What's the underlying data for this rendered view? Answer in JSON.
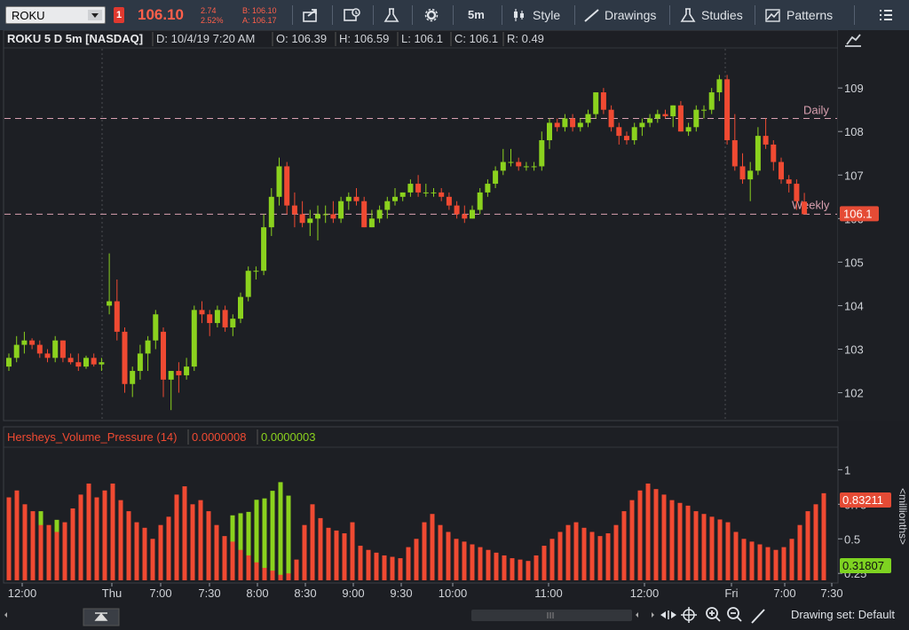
{
  "toolbar": {
    "symbol": "ROKU",
    "alert_badge": "1",
    "last_price": "106.10",
    "net_change": "2.74",
    "pct_change": "2.52%",
    "bid": "B: 106.10",
    "ask": "A: 106.17",
    "aggregation": "5m",
    "style_label": "Style",
    "drawings_label": "Drawings",
    "studies_label": "Studies",
    "patterns_label": "Patterns"
  },
  "header": {
    "title": "ROKU 5 D 5m [NASDAQ]",
    "date": "D: 10/4/19 7:20 AM",
    "open": "O: 106.39",
    "high": "H: 106.59",
    "low": "L: 106.1",
    "close": "C: 106.1",
    "range": "R: 0.49"
  },
  "price_panel": {
    "y_ticks": [
      "109",
      "108",
      "107",
      "106",
      "105",
      "104",
      "103",
      "102"
    ],
    "daily_label": "Daily",
    "weekly_label": "Weekly",
    "current_price_label": "106.1"
  },
  "study": {
    "name": "Hersheys_Volume_Pressure (14)",
    "value_red": "0.0000008",
    "value_green": "0.0000003",
    "y_ticks": [
      "1",
      "0.75",
      "0.5",
      "0.25"
    ],
    "axis_label": "<millionths>",
    "red_readout": "0.83211",
    "green_readout": "0.31807"
  },
  "x_axis": {
    "labels": [
      "12:00",
      "Thu",
      "7:00",
      "7:30",
      "8:00",
      "8:30",
      "9:00",
      "9:30",
      "10:00",
      "11:00",
      "12:00",
      "Fri",
      "7:00",
      "7:30"
    ]
  },
  "bottom": {
    "drawing_set": "Drawing set: Default"
  },
  "colors": {
    "up": "#8bd21e",
    "down": "#f04a32",
    "price_tag": "#e54b35",
    "green_tag": "#7ed321",
    "level_line": "#d9a0b0"
  },
  "chart_data": [
    {
      "type": "candlestick",
      "title": "ROKU 5 D 5m [NASDAQ]",
      "ylim": [
        101.4,
        109.9
      ],
      "y_ticks": [
        109,
        108,
        107,
        106,
        105,
        104,
        103,
        102
      ],
      "levels": [
        {
          "name": "Daily",
          "value": 108.3
        },
        {
          "name": "Weekly",
          "value": 106.1
        }
      ],
      "candles": [
        [
          102.6,
          102.9,
          102.5,
          102.8
        ],
        [
          102.8,
          103.3,
          102.7,
          103.1
        ],
        [
          103.1,
          103.4,
          102.9,
          103.2
        ],
        [
          103.2,
          103.25,
          103.0,
          103.1
        ],
        [
          103.1,
          103.2,
          102.8,
          102.9
        ],
        [
          102.9,
          103.0,
          102.7,
          102.8
        ],
        [
          102.8,
          103.3,
          102.7,
          103.2
        ],
        [
          103.2,
          103.2,
          102.7,
          102.8
        ],
        [
          102.8,
          102.9,
          102.65,
          102.7
        ],
        [
          102.7,
          102.9,
          102.5,
          102.6
        ],
        [
          102.6,
          102.85,
          102.55,
          102.8
        ],
        [
          102.8,
          102.9,
          102.6,
          102.65
        ],
        [
          102.65,
          102.8,
          102.5,
          102.7
        ],
        [
          104.0,
          105.2,
          103.8,
          104.1
        ],
        [
          104.1,
          104.6,
          103.2,
          103.4
        ],
        [
          103.4,
          103.5,
          102.0,
          102.2
        ],
        [
          102.2,
          102.6,
          101.9,
          102.5
        ],
        [
          102.5,
          103.1,
          102.3,
          102.9
        ],
        [
          102.9,
          103.3,
          102.5,
          103.2
        ],
        [
          103.2,
          103.9,
          103.0,
          103.8
        ],
        [
          103.4,
          103.5,
          101.9,
          102.3
        ],
        [
          102.3,
          102.5,
          101.6,
          102.5
        ],
        [
          102.5,
          102.7,
          102.0,
          102.4
        ],
        [
          102.4,
          102.8,
          102.3,
          102.6
        ],
        [
          102.6,
          104.0,
          102.5,
          103.9
        ],
        [
          103.9,
          104.1,
          103.6,
          103.8
        ],
        [
          103.8,
          103.9,
          103.3,
          103.6
        ],
        [
          103.6,
          104.0,
          103.5,
          103.9
        ],
        [
          103.9,
          104.0,
          103.4,
          103.5
        ],
        [
          103.5,
          103.8,
          103.3,
          103.7
        ],
        [
          103.7,
          104.3,
          103.6,
          104.2
        ],
        [
          104.2,
          104.9,
          104.1,
          104.8
        ],
        [
          104.8,
          104.9,
          104.6,
          104.8
        ],
        [
          104.8,
          106.1,
          104.7,
          105.8
        ],
        [
          105.8,
          106.7,
          105.6,
          106.5
        ],
        [
          106.5,
          107.4,
          106.3,
          107.2
        ],
        [
          107.2,
          107.3,
          106.1,
          106.3
        ],
        [
          106.3,
          106.6,
          105.8,
          106.1
        ],
        [
          106.1,
          106.4,
          105.8,
          105.9
        ],
        [
          105.9,
          106.2,
          105.6,
          106.0
        ],
        [
          106.0,
          106.3,
          105.5,
          106.1
        ],
        [
          106.1,
          106.3,
          105.9,
          106.1
        ],
        [
          106.1,
          106.4,
          105.9,
          106.0
        ],
        [
          106.0,
          106.5,
          105.9,
          106.4
        ],
        [
          106.4,
          106.6,
          106.2,
          106.5
        ],
        [
          106.5,
          106.7,
          106.3,
          106.4
        ],
        [
          106.4,
          106.5,
          105.8,
          105.8
        ],
        [
          105.8,
          106.2,
          105.8,
          106.0
        ],
        [
          106.0,
          106.3,
          105.9,
          106.2
        ],
        [
          106.2,
          106.5,
          106.0,
          106.4
        ],
        [
          106.4,
          106.7,
          106.3,
          106.5
        ],
        [
          106.5,
          106.6,
          106.4,
          106.6
        ],
        [
          106.6,
          106.9,
          106.5,
          106.8
        ],
        [
          106.8,
          107.0,
          106.5,
          106.6
        ],
        [
          106.6,
          106.8,
          106.5,
          106.6
        ],
        [
          106.6,
          106.7,
          106.5,
          106.6
        ],
        [
          106.6,
          106.7,
          106.4,
          106.5
        ],
        [
          106.5,
          106.6,
          106.2,
          106.3
        ],
        [
          106.3,
          106.4,
          106.0,
          106.1
        ],
        [
          106.1,
          106.3,
          105.9,
          106.0
        ],
        [
          106.0,
          106.3,
          106.0,
          106.2
        ],
        [
          106.2,
          106.7,
          106.1,
          106.6
        ],
        [
          106.6,
          106.9,
          106.5,
          106.8
        ],
        [
          106.8,
          107.2,
          106.7,
          107.1
        ],
        [
          107.1,
          107.6,
          107.0,
          107.3
        ],
        [
          107.3,
          107.6,
          107.2,
          107.3
        ],
        [
          107.3,
          107.4,
          107.1,
          107.2
        ],
        [
          107.2,
          107.3,
          107.1,
          107.2
        ],
        [
          107.2,
          107.3,
          107.1,
          107.2
        ],
        [
          107.2,
          108.0,
          107.1,
          107.8
        ],
        [
          107.8,
          108.3,
          107.6,
          108.2
        ],
        [
          108.2,
          108.3,
          108.0,
          108.1
        ],
        [
          108.1,
          108.4,
          108.0,
          108.3
        ],
        [
          108.3,
          108.4,
          108.0,
          108.1
        ],
        [
          108.1,
          108.3,
          108.0,
          108.2
        ],
        [
          108.2,
          108.5,
          108.1,
          108.4
        ],
        [
          108.4,
          108.9,
          108.3,
          108.9
        ],
        [
          108.9,
          109.0,
          108.4,
          108.5
        ],
        [
          108.5,
          108.6,
          108.0,
          108.1
        ],
        [
          108.1,
          108.2,
          107.7,
          107.9
        ],
        [
          107.9,
          108.0,
          107.7,
          107.8
        ],
        [
          107.8,
          108.2,
          107.7,
          108.1
        ],
        [
          108.1,
          108.3,
          107.9,
          108.2
        ],
        [
          108.2,
          108.4,
          108.1,
          108.3
        ],
        [
          108.3,
          108.5,
          108.2,
          108.4
        ],
        [
          108.4,
          108.5,
          108.3,
          108.35
        ],
        [
          108.35,
          108.6,
          108.1,
          108.6
        ],
        [
          108.6,
          108.7,
          108.0,
          108.0
        ],
        [
          108.0,
          108.2,
          107.9,
          108.1
        ],
        [
          108.1,
          108.6,
          108.0,
          108.5
        ],
        [
          108.5,
          108.6,
          108.3,
          108.5
        ],
        [
          108.5,
          109.0,
          108.4,
          108.9
        ],
        [
          108.9,
          109.3,
          108.7,
          109.2
        ],
        [
          109.2,
          109.3,
          107.7,
          107.8
        ],
        [
          107.8,
          108.4,
          107.1,
          107.2
        ],
        [
          107.2,
          107.5,
          106.8,
          106.9
        ],
        [
          106.9,
          107.3,
          106.4,
          107.1
        ],
        [
          107.1,
          108.1,
          107.0,
          107.9
        ],
        [
          107.9,
          108.3,
          107.6,
          107.7
        ],
        [
          107.7,
          107.8,
          107.1,
          107.3
        ],
        [
          107.3,
          107.4,
          106.8,
          106.9
        ],
        [
          106.9,
          107.0,
          106.6,
          106.8
        ],
        [
          106.8,
          106.9,
          106.2,
          106.4
        ],
        [
          106.39,
          106.59,
          106.1,
          106.1
        ]
      ]
    },
    {
      "type": "bar",
      "title": "Hersheys_Volume_Pressure (14)",
      "ylim": [
        0.2,
        1.15
      ],
      "y_ticks": [
        1,
        0.75,
        0.5,
        0.25
      ],
      "series": [
        {
          "name": "Hersheys_Volume_Pressure (14)",
          "values": [
            0.8,
            0.85,
            0.75,
            0.7,
            0.6,
            0.6,
            0.55,
            0.62,
            0.72,
            0.82,
            0.9,
            0.8,
            0.85,
            0.9,
            0.78,
            0.7,
            0.62,
            0.58,
            0.5,
            0.6,
            0.66,
            0.82,
            0.88,
            0.75,
            0.78,
            0.7,
            0.6,
            0.52,
            0.48,
            0.42,
            0.38,
            0.33,
            0.29,
            0.27,
            0.24,
            0.25,
            0.35,
            0.6,
            0.75,
            0.65,
            0.58,
            0.56,
            0.54,
            0.62,
            0.45,
            0.42,
            0.4,
            0.38,
            0.37,
            0.36,
            0.44,
            0.5,
            0.62,
            0.68,
            0.6,
            0.55,
            0.5,
            0.48,
            0.46,
            0.44,
            0.42,
            0.4,
            0.38,
            0.36,
            0.35,
            0.34,
            0.38,
            0.45,
            0.5,
            0.55,
            0.6,
            0.62,
            0.58,
            0.55,
            0.52,
            0.54,
            0.6,
            0.7,
            0.78,
            0.85,
            0.9,
            0.86,
            0.82,
            0.78,
            0.76,
            0.74,
            0.7,
            0.68,
            0.66,
            0.64,
            0.62,
            0.55,
            0.5,
            0.48,
            0.46,
            0.44,
            0.42,
            0.44,
            0.5,
            0.6,
            0.7,
            0.75,
            0.83
          ]
        },
        {
          "name": "green",
          "values": [
            0.0,
            0.0,
            0.0,
            0.0,
            0.55,
            0.0,
            0.5,
            0.0,
            0.0,
            0.0,
            0.0,
            0.0,
            0.0,
            0.0,
            0.0,
            0.0,
            0.0,
            0.0,
            0.0,
            0.0,
            0.0,
            0.0,
            0.0,
            0.0,
            0.0,
            0.0,
            0.0,
            0.0,
            0.55,
            0.58,
            0.6,
            0.7,
            0.72,
            0.78,
            0.85,
            0.75,
            0.0,
            0.0,
            0.0,
            0.0,
            0.0,
            0.0,
            0.0,
            0.0,
            0.0,
            0.0,
            0.0,
            0.0,
            0.0,
            0.0,
            0.0,
            0.0,
            0.0,
            0.0,
            0.0,
            0.0,
            0.0,
            0.0,
            0.0,
            0.0,
            0.0,
            0.0,
            0.0,
            0.0,
            0.0,
            0.0,
            0.0,
            0.0,
            0.0,
            0.0,
            0.0,
            0.0,
            0.0,
            0.0,
            0.0,
            0.0,
            0.0,
            0.0,
            0.0,
            0.0,
            0.0,
            0.0,
            0.0,
            0.0,
            0.0,
            0.0,
            0.0,
            0.0,
            0.0,
            0.0,
            0.0,
            0.0,
            0.0,
            0.0,
            0.0,
            0.0,
            0.0,
            0.0,
            0.0,
            0.0,
            0.0,
            0.0,
            0.32
          ]
        }
      ]
    }
  ]
}
